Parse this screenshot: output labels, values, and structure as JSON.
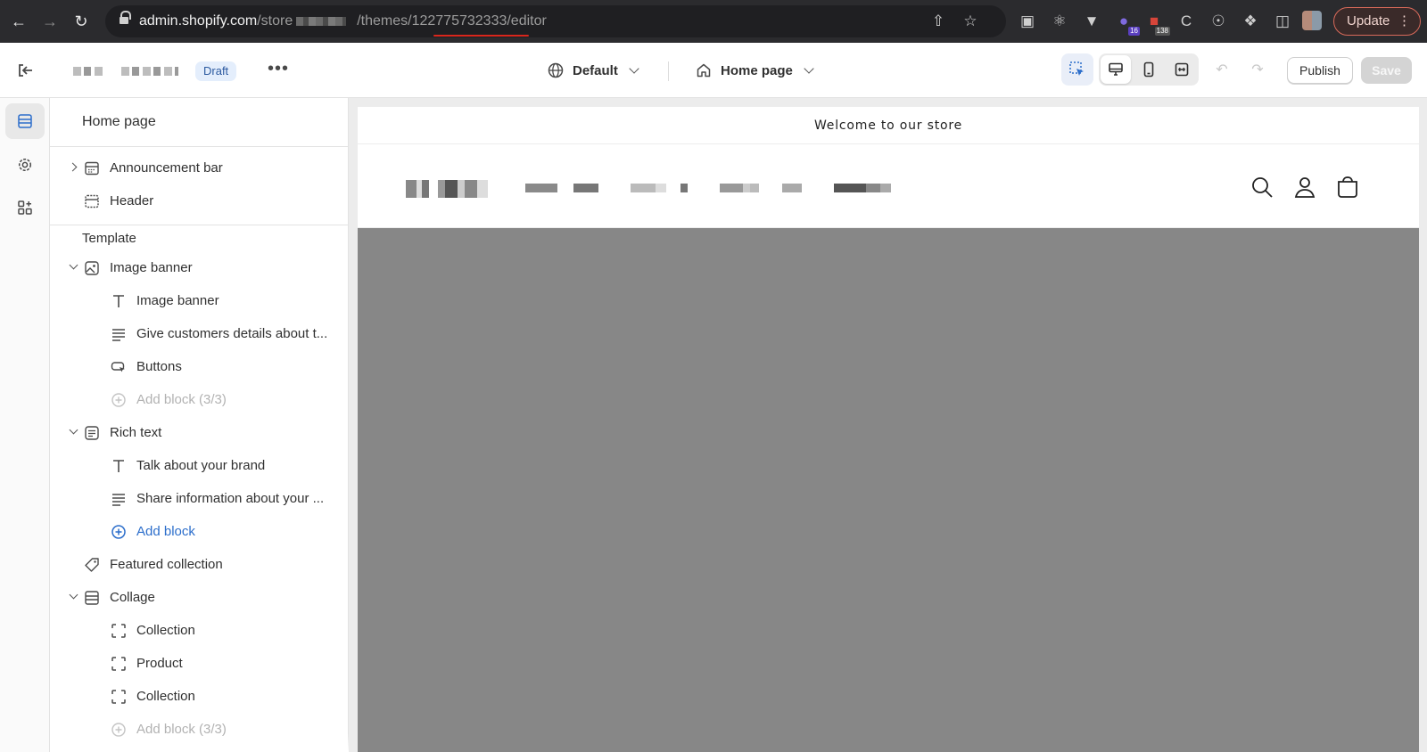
{
  "browser": {
    "url_host": "admin.shopify.com",
    "url_path_prefix": "/store",
    "url_path_suffix": "/themes/122775732333/editor",
    "update_label": "Update",
    "extension_badges": [
      "16",
      "138"
    ]
  },
  "topbar": {
    "draft_label": "Draft",
    "theme_label": "Default",
    "page_label": "Home page",
    "publish_label": "Publish",
    "save_label": "Save"
  },
  "sidebar": {
    "title": "Home page",
    "header_sections": [
      {
        "label": "Announcement bar",
        "icon": "section-icon",
        "expandable": true
      },
      {
        "label": "Header",
        "icon": "section-icon"
      }
    ],
    "template_label": "Template",
    "items": [
      {
        "label": "Image banner",
        "icon": "image-banner-icon",
        "level": 0,
        "caret": "down"
      },
      {
        "label": "Image banner",
        "icon": "heading-icon",
        "level": 1
      },
      {
        "label": "Give customers details about t...",
        "icon": "text-icon",
        "level": 1
      },
      {
        "label": "Buttons",
        "icon": "buttons-icon",
        "level": 1
      },
      {
        "label": "Add block (3/3)",
        "icon": "add-icon",
        "level": 1,
        "state": "disabled"
      },
      {
        "label": "Rich text",
        "icon": "rich-text-icon",
        "level": 0,
        "caret": "down"
      },
      {
        "label": "Talk about your brand",
        "icon": "heading-icon",
        "level": 1
      },
      {
        "label": "Share information about your ...",
        "icon": "text-icon",
        "level": 1
      },
      {
        "label": "Add block",
        "icon": "add-icon",
        "level": 1,
        "state": "link"
      },
      {
        "label": "Featured collection",
        "icon": "tag-icon",
        "level": 0
      },
      {
        "label": "Collage",
        "icon": "collage-icon",
        "level": 0,
        "caret": "down"
      },
      {
        "label": "Collection",
        "icon": "block-icon",
        "level": 1
      },
      {
        "label": "Product",
        "icon": "block-icon",
        "level": 1
      },
      {
        "label": "Collection",
        "icon": "block-icon",
        "level": 1
      },
      {
        "label": "Add block (3/3)",
        "icon": "add-icon",
        "level": 1,
        "state": "disabled"
      }
    ]
  },
  "preview": {
    "announcement_text": "Welcome to our store"
  },
  "colors": {
    "accent_link": "#2c6ecb",
    "banner_gray": "#878787",
    "chrome_dark": "#2b2b2e",
    "url_underline": "#d9261c"
  }
}
